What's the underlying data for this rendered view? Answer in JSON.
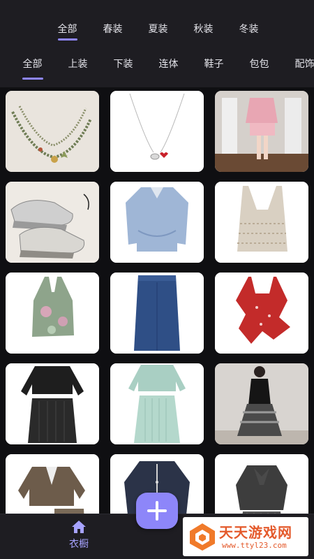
{
  "season_tabs": [
    {
      "label": "全部",
      "active": true
    },
    {
      "label": "春装",
      "active": false
    },
    {
      "label": "夏装",
      "active": false
    },
    {
      "label": "秋装",
      "active": false
    },
    {
      "label": "冬装",
      "active": false
    }
  ],
  "category_tabs": [
    {
      "label": "全部",
      "active": true
    },
    {
      "label": "上装",
      "active": false
    },
    {
      "label": "下装",
      "active": false
    },
    {
      "label": "连体",
      "active": false
    },
    {
      "label": "鞋子",
      "active": false
    },
    {
      "label": "包包",
      "active": false
    },
    {
      "label": "配饰",
      "active": false
    }
  ],
  "items": [
    {
      "icon": "beaded-necklace-photo"
    },
    {
      "icon": "pendant-necklace-photo"
    },
    {
      "icon": "pink-cardigan-set-photo"
    },
    {
      "icon": "chunky-sneakers-photo"
    },
    {
      "icon": "denim-shirt-photo"
    },
    {
      "icon": "crochet-tank-top-photo"
    },
    {
      "icon": "halter-top-photo"
    },
    {
      "icon": "denim-skirt-photo"
    },
    {
      "icon": "red-ruffle-top-photo"
    },
    {
      "icon": "black-knit-set-photo"
    },
    {
      "icon": "mint-knit-set-photo"
    },
    {
      "icon": "black-dress-photo"
    },
    {
      "icon": "tweed-jacket-photo"
    },
    {
      "icon": "navy-cardigan-photo"
    },
    {
      "icon": "bow-blouse-photo"
    }
  ],
  "bottom_nav": {
    "wardrobe_label": "衣橱",
    "wardrobe_icon": "home-icon"
  },
  "fab": {
    "icon": "plus-icon"
  },
  "watermark": {
    "title": "天天游戏网",
    "url": "www.ttyl23.com"
  },
  "colors": {
    "accent": "#8e86ff",
    "background": "#1e1d22",
    "grid_background": "#0f0f12"
  }
}
